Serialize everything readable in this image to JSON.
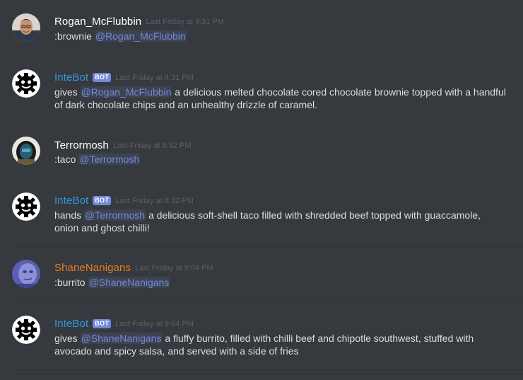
{
  "colors": {
    "background": "#36393e",
    "text": "#dcddde",
    "timestamp": "#5c5f66",
    "mention": "#7289da",
    "bot_tag": "#7289da",
    "rogan": "#ffffff",
    "intebot": "#3498db",
    "terrormosh": "#ffffff",
    "shanenanigans": "#e67e22"
  },
  "messages": [
    {
      "author": "Rogan_McFlubbin",
      "author_color": "#ffffff",
      "avatar_icon": "user-photo-avatar",
      "bot": false,
      "timestamp": "Last Friday at 4:31 PM",
      "pre": ":brownie ",
      "mention": "@Rogan_McFlubbin",
      "post": ""
    },
    {
      "author": "InteBot",
      "author_color": "#3498db",
      "avatar_icon": "gear-robot-icon",
      "bot": true,
      "bot_label": "BOT",
      "timestamp": "Last Friday at 4:31 PM",
      "pre": "gives ",
      "mention": "@Rogan_McFlubbin",
      "post": " a delicious melted chocolate cored chocolate brownie topped with a handful of dark chocolate chips and an unhealthy drizzle of caramel."
    },
    {
      "author": "Terrormosh",
      "author_color": "#ffffff",
      "avatar_icon": "helmet-avatar",
      "bot": false,
      "timestamp": "Last Friday at 8:32 PM",
      "pre": ":taco ",
      "mention": "@Terrormosh",
      "post": ""
    },
    {
      "author": "InteBot",
      "author_color": "#3498db",
      "avatar_icon": "gear-robot-icon",
      "bot": true,
      "bot_label": "BOT",
      "timestamp": "Last Friday at 8:32 PM",
      "pre": "hands ",
      "mention": "@Terrormosh",
      "post": " a delicious soft-shell taco filled with shredded beef topped with guaccamole, onion and ghost chilli!"
    },
    {
      "author": "ShaneNanigans",
      "author_color": "#e67e22",
      "avatar_icon": "purple-face-avatar",
      "bot": false,
      "timestamp": "Last Friday at 9:04 PM",
      "pre": ":burrito ",
      "mention": "@ShaneNanigans",
      "post": ""
    },
    {
      "author": "InteBot",
      "author_color": "#3498db",
      "avatar_icon": "gear-robot-icon",
      "bot": true,
      "bot_label": "BOT",
      "timestamp": "Last Friday at 9:04 PM",
      "pre": "gives ",
      "mention": "@ShaneNanigans",
      "post": " a fluffy burrito, filled with chilli beef and chipotle southwest, stuffed with avocado and spicy salsa, and served with a side  of fries"
    }
  ]
}
